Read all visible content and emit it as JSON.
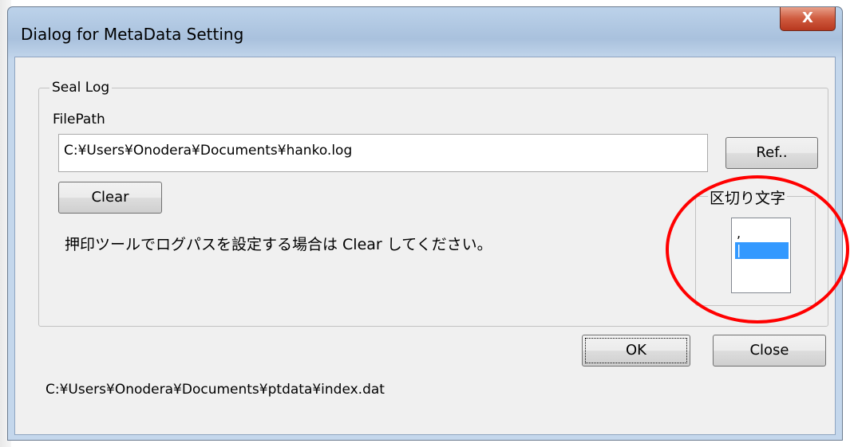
{
  "window": {
    "title": "Dialog for MetaData Setting",
    "close_glyph": "X"
  },
  "seal_log": {
    "group_label": "Seal Log",
    "filepath_label": "FilePath",
    "filepath_value": "C:¥Users¥Onodera¥Documents¥hanko.log",
    "ref_button": "Ref..",
    "clear_button": "Clear",
    "hint": "押印ツールでログパスを設定する場合は Clear してください。",
    "delimiter": {
      "label": "区切り文字",
      "options": [
        ",",
        "|"
      ],
      "selected_index": 1
    }
  },
  "buttons": {
    "ok": "OK",
    "close": "Close"
  },
  "status_path": "C:¥Users¥Onodera¥Documents¥ptdata¥index.dat",
  "colors": {
    "annotation": "#ff0000",
    "selection": "#3399ff",
    "close_button": "#c7472b"
  }
}
